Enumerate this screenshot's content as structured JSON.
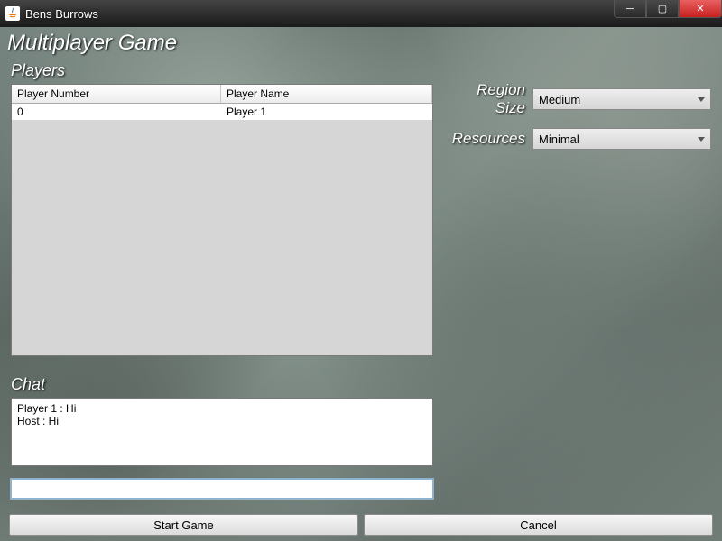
{
  "window": {
    "title": "Bens Burrows"
  },
  "page": {
    "title": "Multiplayer Game"
  },
  "players": {
    "group_label": "Players",
    "columns": [
      "Player Number",
      "Player Name"
    ],
    "rows": [
      {
        "number": "0",
        "name": "Player 1"
      }
    ]
  },
  "chat": {
    "group_label": "Chat",
    "log": "Player 1 : Hi\nHost : Hi",
    "input_value": ""
  },
  "settings": {
    "region_size": {
      "label": "Region Size",
      "value": "Medium"
    },
    "resources": {
      "label": "Resources",
      "value": "Minimal"
    }
  },
  "buttons": {
    "start": "Start Game",
    "cancel": "Cancel"
  }
}
